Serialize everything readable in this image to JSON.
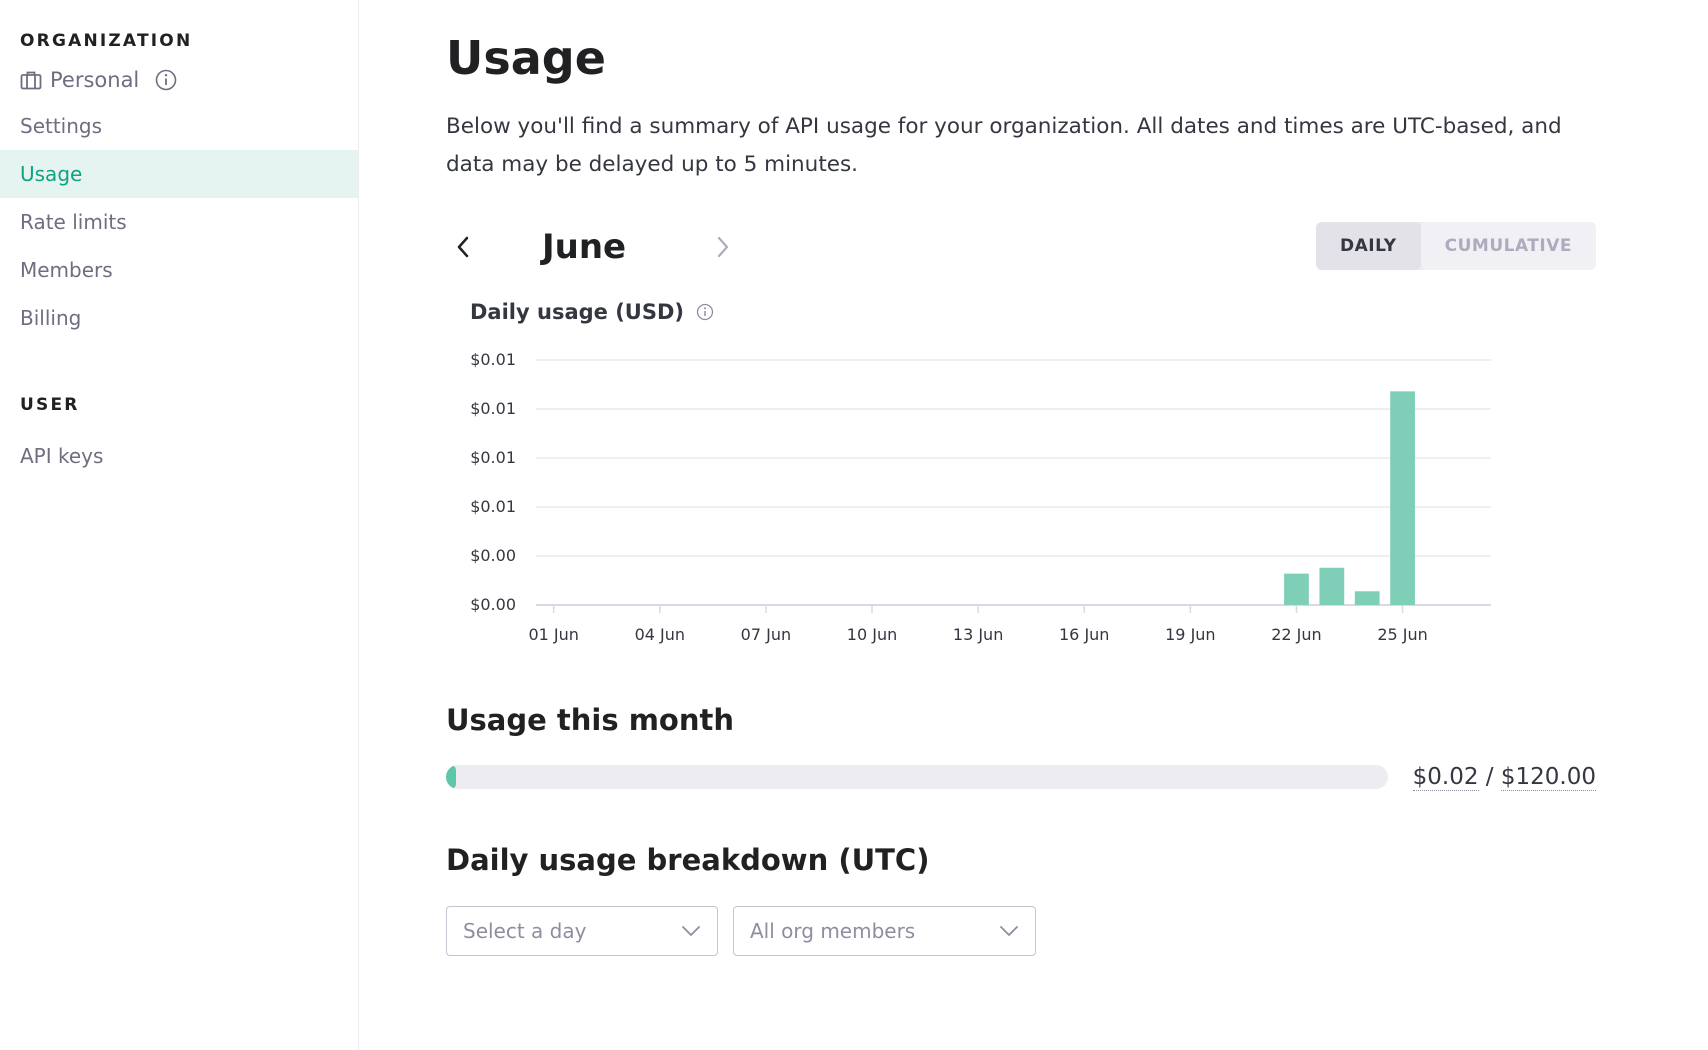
{
  "sidebar": {
    "org_heading": "ORGANIZATION",
    "org_name": "Personal",
    "items": [
      {
        "label": "Settings",
        "active": false
      },
      {
        "label": "Usage",
        "active": true
      },
      {
        "label": "Rate limits",
        "active": false
      },
      {
        "label": "Members",
        "active": false
      },
      {
        "label": "Billing",
        "active": false
      }
    ],
    "user_heading": "USER",
    "user_items": [
      {
        "label": "API keys"
      }
    ]
  },
  "main": {
    "title": "Usage",
    "intro": "Below you'll find a summary of API usage for your organization. All dates and times are UTC-based, and data may be delayed up to 5 minutes.",
    "month": "June",
    "toggle": {
      "daily": "DAILY",
      "cumulative": "CUMULATIVE",
      "selected": "daily"
    },
    "chart_title": "Daily usage (USD)",
    "month_usage_title": "Usage this month",
    "month_usage": {
      "used": "$0.02",
      "separator": " / ",
      "limit": "$120.00",
      "fraction": 0.00017
    },
    "breakdown_title": "Daily usage breakdown (UTC)",
    "day_select_placeholder": "Select a day",
    "members_select_value": "All org members"
  },
  "colors": {
    "accent": "#10a37f",
    "bar": "#7fcfb8",
    "active_bg": "#e6f4f1"
  },
  "chart_data": {
    "type": "bar",
    "title": "Daily usage (USD)",
    "xlabel": "",
    "ylabel": "",
    "y_tick_labels": [
      "$0.00",
      "$0.00",
      "$0.01",
      "$0.01",
      "$0.01",
      "$0.01"
    ],
    "ylim": [
      0,
      0.0125
    ],
    "x_tick_labels": [
      "01 Jun",
      "04 Jun",
      "07 Jun",
      "10 Jun",
      "13 Jun",
      "16 Jun",
      "19 Jun",
      "22 Jun",
      "25 Jun"
    ],
    "categories": [
      "01 Jun",
      "02 Jun",
      "03 Jun",
      "04 Jun",
      "05 Jun",
      "06 Jun",
      "07 Jun",
      "08 Jun",
      "09 Jun",
      "10 Jun",
      "11 Jun",
      "12 Jun",
      "13 Jun",
      "14 Jun",
      "15 Jun",
      "16 Jun",
      "17 Jun",
      "18 Jun",
      "19 Jun",
      "20 Jun",
      "21 Jun",
      "22 Jun",
      "23 Jun",
      "24 Jun",
      "25 Jun",
      "26 Jun",
      "27 Jun"
    ],
    "values": [
      0,
      0,
      0,
      0,
      0,
      0,
      0,
      0,
      0,
      0,
      0,
      0,
      0,
      0,
      0,
      0,
      0,
      0,
      0,
      0,
      0,
      0.0016,
      0.0019,
      0.0007,
      0.0109,
      0,
      0
    ],
    "grid": true
  }
}
